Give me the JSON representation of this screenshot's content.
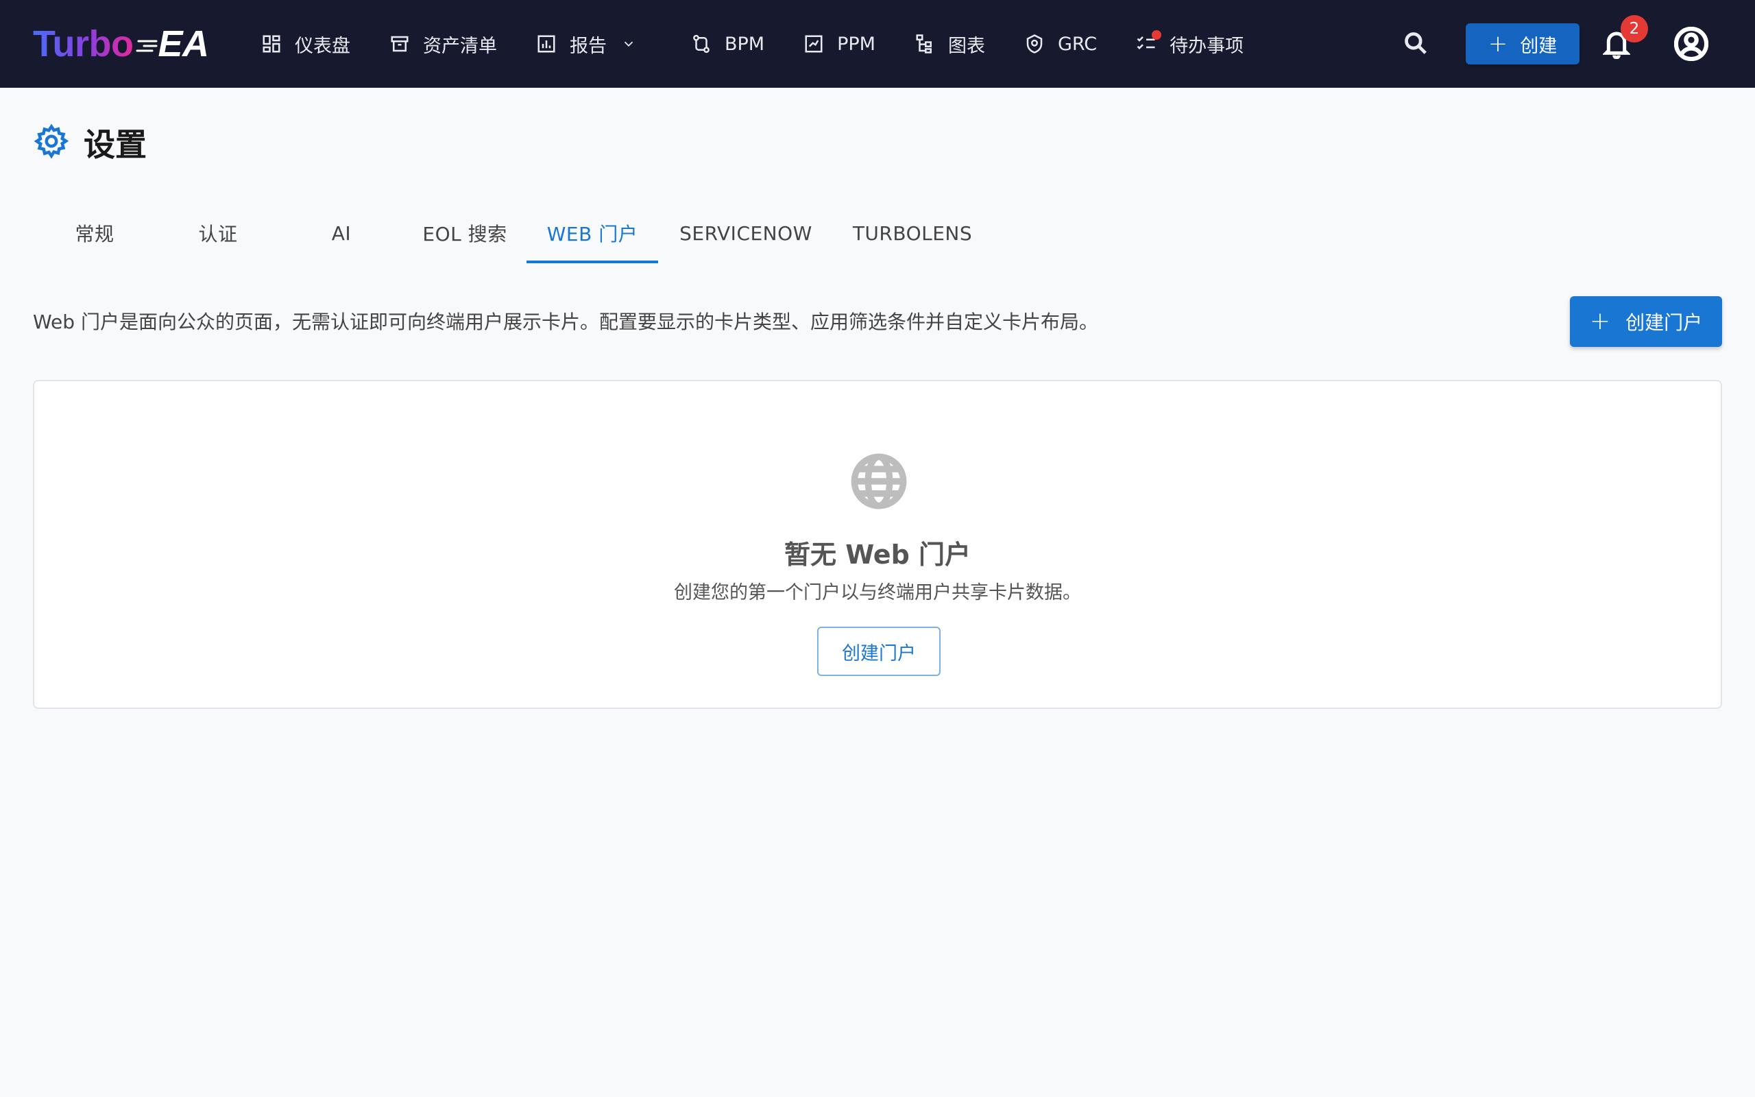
{
  "app": {
    "logo_part1": "Turbo",
    "logo_part2": "EA"
  },
  "nav": {
    "items": [
      {
        "label": "仪表盘",
        "icon": "dashboard-icon"
      },
      {
        "label": "资产清单",
        "icon": "inventory-icon"
      },
      {
        "label": "报告",
        "icon": "report-icon",
        "has_dropdown": true
      },
      {
        "label": "BPM",
        "icon": "bpm-icon"
      },
      {
        "label": "PPM",
        "icon": "ppm-icon"
      },
      {
        "label": "图表",
        "icon": "diagram-icon"
      },
      {
        "label": "GRC",
        "icon": "grc-icon"
      },
      {
        "label": "待办事项",
        "icon": "todo-icon",
        "has_dot": true
      }
    ],
    "create_label": "创建",
    "notification_count": "2"
  },
  "page": {
    "title": "设置",
    "tabs": [
      {
        "label": "常规"
      },
      {
        "label": "认证"
      },
      {
        "label": "AI"
      },
      {
        "label": "EOL 搜索"
      },
      {
        "label": "WEB 门户",
        "active": true
      },
      {
        "label": "SERVICENOW"
      },
      {
        "label": "TURBOLENS"
      }
    ],
    "description": "Web 门户是面向公众的页面，无需认证即可向终端用户展示卡片。配置要显示的卡片类型、应用筛选条件并自定义卡片布局。",
    "create_portal_label": "创建门户"
  },
  "empty_state": {
    "title": "暂无 Web 门户",
    "subtitle": "创建您的第一个门户以与终端用户共享卡片数据。",
    "button_label": "创建门户"
  },
  "colors": {
    "topbar_bg": "#171a2e",
    "accent": "#1976d2",
    "badge": "#e53935"
  }
}
